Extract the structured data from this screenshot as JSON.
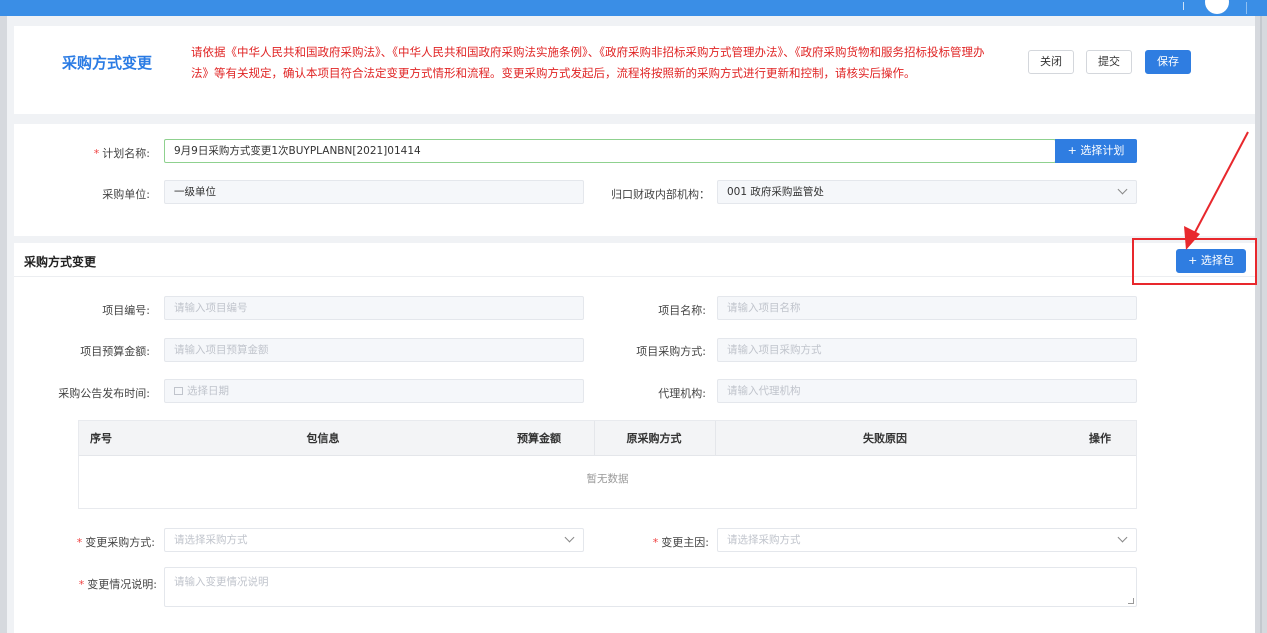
{
  "header": {
    "title": "采购方式变更",
    "notice": "请依据《中华人民共和国政府采购法》、《中华人民共和国政府采购法实施条例》、《政府采购非招标采购方式管理办法》、《政府采购货物和服务招标投标管理办法》等有关规定，确认本项目符合法定变更方式情形和流程。变更采购方式发起后，流程将按照新的采购方式进行更新和控制，请核实后操作。",
    "close_label": "关闭",
    "submit_label": "提交",
    "save_label": "保存"
  },
  "plan": {
    "plan_name_label": "计划名称:",
    "plan_name_value": "9月9日采购方式变更1次BUYPLANBN[2021]01414",
    "select_plan_label": "+ 选择计划",
    "unit_label": "采购单位:",
    "unit_value": "一级单位",
    "finance_label": "归口财政内部机构：",
    "finance_value": "001  政府采购监管处"
  },
  "change": {
    "section_title": "采购方式变更",
    "select_package_label": "+ 选择包",
    "project_no_label": "项目编号:",
    "project_no_placeholder": "请输入项目编号",
    "project_name_label": "项目名称:",
    "project_name_placeholder": "请输入项目名称",
    "budget_label": "项目预算金额:",
    "budget_placeholder": "请输入项目预算金额",
    "method_label": "项目采购方式:",
    "method_placeholder": "请输入项目采购方式",
    "publish_label": "采购公告发布时间:",
    "publish_placeholder": "选择日期",
    "agency_label": "代理机构:",
    "agency_placeholder": "请输入代理机构",
    "table": {
      "columns": [
        "序号",
        "包信息",
        "预算金额",
        "原采购方式",
        "失败原因",
        "操作"
      ],
      "empty_text": "暂无数据"
    },
    "new_method_label": "变更采购方式:",
    "new_method_placeholder": "请选择采购方式",
    "reason_label": "变更主因:",
    "reason_placeholder": "请选择采购方式",
    "desc_label": "变更情况说明:",
    "desc_placeholder": "请输入变更情况说明"
  }
}
